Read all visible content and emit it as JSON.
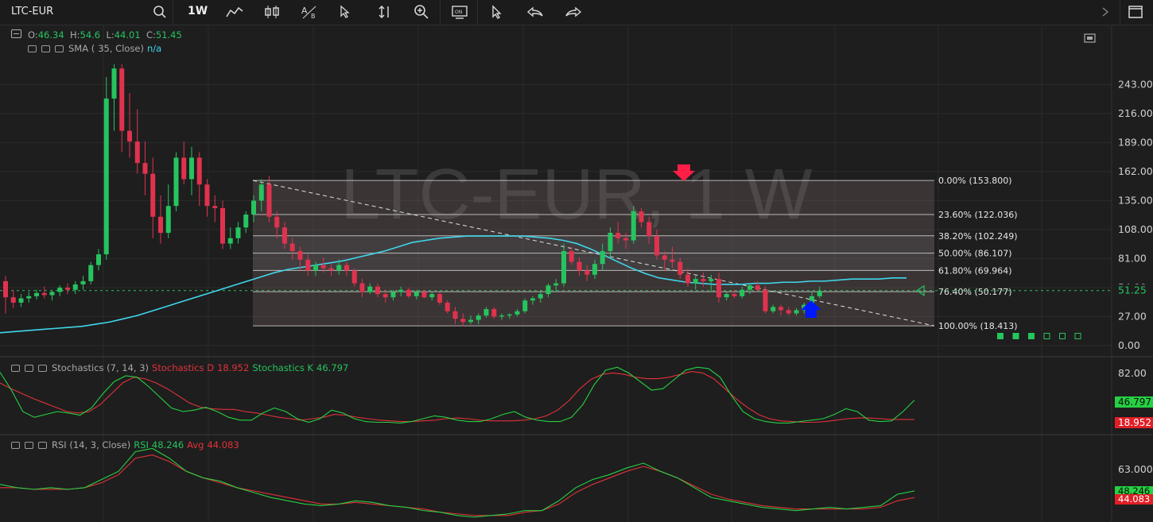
{
  "toolbar": {
    "symbol": "LTC-EUR",
    "interval": "1W",
    "icons": [
      "search-icon",
      "line-tool-icon",
      "candle-type-icon",
      "text-tool-icon",
      "cursor-icon",
      "measure-icon",
      "zoom-icon",
      "replay-icon",
      "select-icon",
      "undo-icon",
      "redo-icon",
      "layout-icon"
    ]
  },
  "legend": {
    "ohlc": {
      "o_label": "O:",
      "o": "46.34",
      "h_label": "H:",
      "h": "54.6",
      "l_label": "L:",
      "l": "44.01",
      "c_label": "C:",
      "c": "51.45"
    },
    "sma": {
      "label": "SMA (",
      "params": "35, Close)",
      "value": "n/a"
    },
    "stoch": {
      "label": "Stochastics (7, 14, 3)",
      "d_label": "Stochastics D",
      "d": "18.952",
      "k_label": "Stochastics K",
      "k": "46.797"
    },
    "rsi": {
      "label": "RSI (14, 3, Close)",
      "rsi_label": "RSI",
      "rsi": "48.246",
      "avg_label": "Avg",
      "avg": "44.083"
    }
  },
  "watermark": "LTC-EUR, 1 W",
  "colors": {
    "bg": "#1e1e1e",
    "up": "#26c45f",
    "down": "#e0324e",
    "sma": "#3fd6ea",
    "fib_fill": "#8a6f6f",
    "d_line": "#e0323a",
    "k_line": "#26d042",
    "marker_down": "#ff1e46",
    "marker_up": "#0018ff"
  },
  "chart_data": [
    {
      "type": "candlestick",
      "title": "LTC-EUR, 1 W",
      "ylim": [
        0,
        260
      ],
      "y_ticks": [
        "243.00",
        "216.00",
        "189.00",
        "162.00",
        "135.00",
        "108.00",
        "81.00",
        "54.00",
        "27.00",
        "0.00"
      ],
      "last_price": "51.25",
      "candles": [
        [
          60,
          65,
          30,
          45
        ],
        [
          45,
          52,
          35,
          40
        ],
        [
          40,
          48,
          36,
          44
        ],
        [
          44,
          50,
          40,
          46
        ],
        [
          46,
          52,
          43,
          49
        ],
        [
          49,
          55,
          44,
          47
        ],
        [
          47,
          52,
          42,
          50
        ],
        [
          50,
          56,
          46,
          54
        ],
        [
          54,
          58,
          48,
          52
        ],
        [
          52,
          60,
          48,
          57
        ],
        [
          57,
          65,
          52,
          60
        ],
        [
          60,
          78,
          57,
          75
        ],
        [
          75,
          90,
          70,
          85
        ],
        [
          85,
          250,
          80,
          230
        ],
        [
          230,
          265,
          200,
          258
        ],
        [
          258,
          265,
          180,
          200
        ],
        [
          200,
          235,
          175,
          190
        ],
        [
          190,
          220,
          160,
          170
        ],
        [
          170,
          190,
          140,
          160
        ],
        [
          160,
          175,
          100,
          120
        ],
        [
          120,
          140,
          95,
          105
        ],
        [
          105,
          150,
          100,
          130
        ],
        [
          130,
          180,
          125,
          175
        ],
        [
          175,
          190,
          150,
          155
        ],
        [
          155,
          185,
          140,
          175
        ],
        [
          175,
          180,
          130,
          150
        ],
        [
          150,
          155,
          120,
          130
        ],
        [
          130,
          140,
          115,
          128
        ],
        [
          128,
          135,
          90,
          95
        ],
        [
          95,
          110,
          90,
          100
        ],
        [
          100,
          115,
          95,
          110
        ],
        [
          110,
          125,
          105,
          122
        ],
        [
          122,
          140,
          115,
          135
        ],
        [
          135,
          155,
          125,
          150
        ],
        [
          150,
          158,
          115,
          120
        ],
        [
          120,
          125,
          100,
          110
        ],
        [
          110,
          115,
          90,
          95
        ],
        [
          95,
          100,
          80,
          88
        ],
        [
          88,
          92,
          70,
          80
        ],
        [
          80,
          85,
          65,
          70
        ],
        [
          70,
          78,
          65,
          75
        ],
        [
          75,
          82,
          68,
          72
        ],
        [
          72,
          76,
          65,
          70
        ],
        [
          70,
          80,
          66,
          75
        ],
        [
          75,
          78,
          65,
          70
        ],
        [
          70,
          72,
          55,
          58
        ],
        [
          58,
          62,
          45,
          50
        ],
        [
          50,
          58,
          48,
          55
        ],
        [
          55,
          58,
          45,
          48
        ],
        [
          48,
          52,
          40,
          45
        ],
        [
          45,
          52,
          42,
          50
        ],
        [
          50,
          55,
          46,
          52
        ],
        [
          52,
          54,
          44,
          46
        ],
        [
          46,
          52,
          43,
          50
        ],
        [
          50,
          52,
          44,
          45
        ],
        [
          45,
          50,
          42,
          48
        ],
        [
          48,
          50,
          38,
          40
        ],
        [
          40,
          42,
          30,
          32
        ],
        [
          32,
          36,
          20,
          25
        ],
        [
          25,
          30,
          18,
          22
        ],
        [
          22,
          28,
          20,
          24
        ],
        [
          24,
          30,
          20,
          28
        ],
        [
          28,
          36,
          26,
          34
        ],
        [
          34,
          36,
          25,
          27
        ],
        [
          27,
          30,
          24,
          28
        ],
        [
          28,
          30,
          25,
          29
        ],
        [
          29,
          34,
          27,
          32
        ],
        [
          32,
          44,
          30,
          42
        ],
        [
          42,
          46,
          38,
          44
        ],
        [
          44,
          50,
          40,
          48
        ],
        [
          48,
          58,
          45,
          56
        ],
        [
          56,
          62,
          50,
          58
        ],
        [
          58,
          95,
          55,
          88
        ],
        [
          88,
          92,
          75,
          78
        ],
        [
          78,
          82,
          65,
          70
        ],
        [
          70,
          75,
          60,
          66
        ],
        [
          66,
          80,
          62,
          76
        ],
        [
          76,
          95,
          70,
          88
        ],
        [
          88,
          110,
          82,
          105
        ],
        [
          105,
          115,
          95,
          100
        ],
        [
          100,
          105,
          90,
          98
        ],
        [
          98,
          130,
          95,
          125
        ],
        [
          125,
          128,
          110,
          115
        ],
        [
          115,
          120,
          95,
          102
        ],
        [
          102,
          108,
          80,
          84
        ],
        [
          84,
          88,
          70,
          80
        ],
        [
          80,
          92,
          72,
          78
        ],
        [
          78,
          82,
          62,
          66
        ],
        [
          66,
          72,
          55,
          58
        ],
        [
          58,
          65,
          52,
          62
        ],
        [
          62,
          68,
          55,
          60
        ],
        [
          60,
          66,
          50,
          62
        ],
        [
          62,
          68,
          40,
          45
        ],
        [
          45,
          50,
          42,
          48
        ],
        [
          48,
          52,
          44,
          46
        ],
        [
          46,
          55,
          44,
          52
        ],
        [
          52,
          58,
          48,
          56
        ],
        [
          56,
          60,
          50,
          52
        ],
        [
          52,
          55,
          30,
          32
        ],
        [
          32,
          38,
          30,
          36
        ],
        [
          36,
          38,
          28,
          33
        ],
        [
          33,
          36,
          28,
          30
        ],
        [
          30,
          35,
          28,
          33
        ],
        [
          33,
          40,
          30,
          38
        ],
        [
          38,
          50,
          35,
          46
        ],
        [
          46,
          55,
          44,
          51
        ]
      ],
      "sma_series": [
        12,
        13,
        14,
        15,
        16,
        17,
        18,
        20,
        22,
        25,
        28,
        32,
        36,
        40,
        44,
        48,
        52,
        56,
        60,
        64,
        68,
        71,
        73,
        75,
        77,
        79,
        82,
        85,
        88,
        92,
        96,
        98,
        100,
        101,
        102,
        102,
        102,
        102,
        102,
        101,
        100,
        98,
        95,
        90,
        84,
        78,
        72,
        67,
        63,
        61,
        59,
        58,
        57,
        57,
        57,
        58,
        58,
        59,
        59,
        60,
        60,
        61,
        62,
        62,
        62,
        63,
        63
      ],
      "fibonacci": [
        {
          "level": "0.00% (153.800)",
          "price": 153.8
        },
        {
          "level": "23.60% (122.036)",
          "price": 122.036
        },
        {
          "level": "38.20% (102.249)",
          "price": 102.249
        },
        {
          "level": "50.00% (86.107)",
          "price": 86.107
        },
        {
          "level": "61.80% (69.964)",
          "price": 69.964
        },
        {
          "level": "76.40% (50.177)",
          "price": 50.177
        },
        {
          "level": "100.00% (18.413)",
          "price": 18.413
        }
      ]
    },
    {
      "type": "line",
      "title": "Stochastics (7, 14, 3)",
      "y_ticks": [
        "82.00"
      ],
      "series": [
        {
          "name": "Stochastics D",
          "last": "18.952",
          "values": [
            70,
            62,
            55,
            48,
            42,
            36,
            30,
            28,
            30,
            40,
            55,
            70,
            78,
            76,
            70,
            62,
            52,
            42,
            36,
            34,
            33,
            33,
            30,
            28,
            25,
            22,
            20,
            18,
            20,
            22,
            26,
            25,
            22,
            20,
            18,
            17,
            16,
            16,
            17,
            18,
            20,
            21,
            20,
            18,
            17,
            17,
            17,
            18,
            20,
            24,
            32,
            45,
            62,
            75,
            82,
            84,
            82,
            78,
            76,
            76,
            78,
            82,
            86,
            84,
            76,
            62,
            48,
            36,
            26,
            20,
            17,
            16,
            15,
            15,
            16,
            18,
            20,
            21,
            21,
            20,
            19,
            19,
            19
          ]
        },
        {
          "name": "Stochastics K",
          "last": "46.797",
          "values": [
            85,
            60,
            30,
            22,
            26,
            30,
            28,
            25,
            35,
            55,
            72,
            80,
            78,
            65,
            50,
            35,
            30,
            32,
            36,
            30,
            22,
            18,
            18,
            28,
            35,
            30,
            20,
            15,
            20,
            32,
            28,
            20,
            16,
            15,
            15,
            14,
            16,
            20,
            24,
            22,
            18,
            16,
            16,
            20,
            26,
            30,
            22,
            18,
            16,
            16,
            22,
            40,
            68,
            88,
            92,
            84,
            72,
            60,
            62,
            75,
            88,
            92,
            90,
            78,
            52,
            30,
            20,
            16,
            14,
            14,
            16,
            18,
            20,
            26,
            34,
            30,
            18,
            16,
            17,
            30,
            46
          ]
        }
      ]
    },
    {
      "type": "line",
      "title": "RSI (14, 3, Close)",
      "y_ticks": [
        "63.0000"
      ],
      "series": [
        {
          "name": "RSI",
          "last": "48.246",
          "values": [
            52,
            50,
            49,
            50,
            49,
            50,
            55,
            60,
            72,
            74,
            68,
            60,
            56,
            54,
            50,
            47,
            44,
            42,
            40,
            39,
            40,
            42,
            41,
            39,
            38,
            36,
            35,
            33,
            32,
            33,
            34,
            36,
            36,
            42,
            50,
            55,
            58,
            62,
            65,
            60,
            56,
            50,
            44,
            42,
            40,
            38,
            37,
            36,
            37,
            38,
            37,
            38,
            39,
            46,
            48
          ]
        },
        {
          "name": "Avg",
          "last": "44.083",
          "values": [
            50,
            50,
            49,
            49,
            49,
            50,
            53,
            58,
            68,
            70,
            66,
            60,
            56,
            53,
            50,
            48,
            46,
            44,
            42,
            40,
            40,
            41,
            40,
            39,
            38,
            37,
            35,
            34,
            33,
            33,
            33,
            35,
            36,
            40,
            47,
            52,
            56,
            60,
            63,
            60,
            56,
            51,
            46,
            43,
            41,
            39,
            38,
            37,
            37,
            37,
            37,
            37,
            38,
            42,
            44
          ]
        }
      ]
    }
  ]
}
